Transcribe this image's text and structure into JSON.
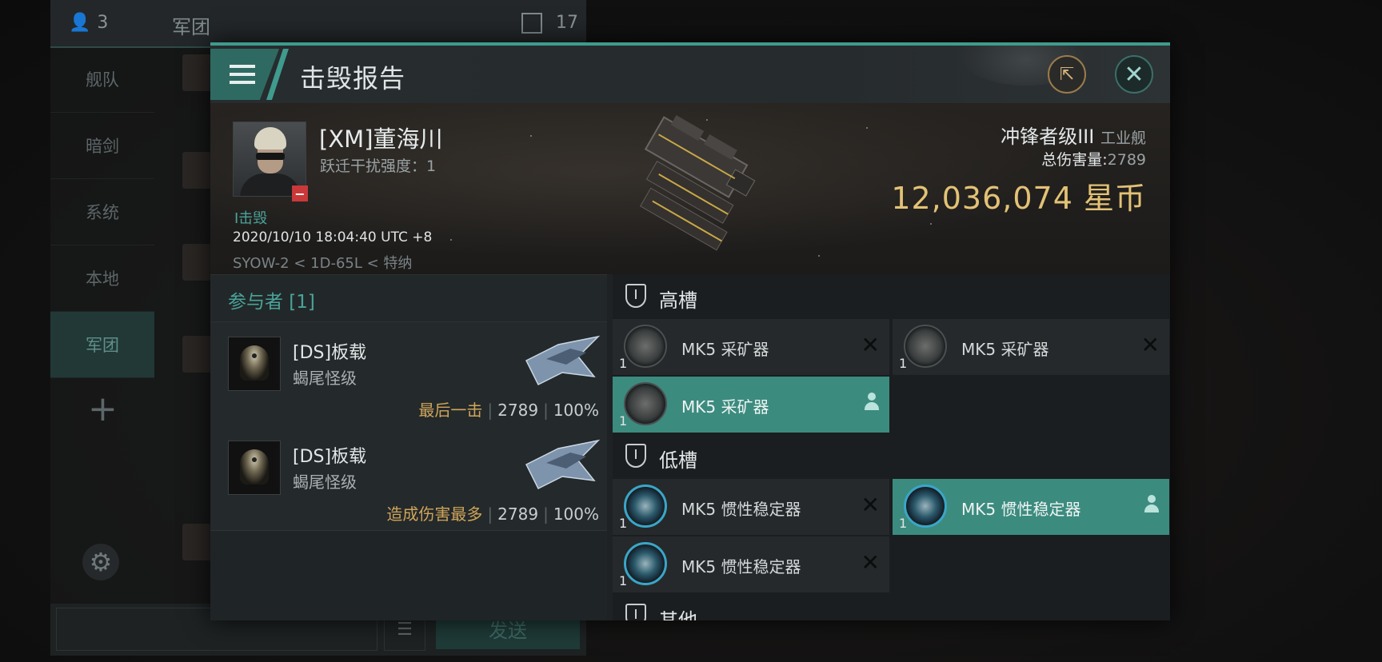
{
  "background": {
    "member_count": "3",
    "channel_title": "军团",
    "message_count": "17",
    "sidebar": [
      {
        "label": "舰队"
      },
      {
        "label": "暗剑"
      },
      {
        "label": "系统"
      },
      {
        "label": "本地"
      },
      {
        "label": "军团"
      }
    ],
    "send_label": "发送"
  },
  "dialog": {
    "title": "击毁报告",
    "victim": {
      "name": "[XM]董海川",
      "warp_disruption": "跃迁干扰强度：1",
      "kill_tag": "I击毁",
      "time": "2020/10/10 18:04:40 UTC +8",
      "location": "SYOW-2 < 1D-65L < 特纳",
      "ship_name": "冲锋者级III",
      "ship_type": "工业舰",
      "damage_label": "总伤害量:",
      "damage_value": "2789",
      "isk_value": "12,036,074",
      "isk_unit": "星币"
    },
    "participants": {
      "title": "参与者 [1]",
      "rows": [
        {
          "name": "[DS]板载",
          "ship": "蝎尾怪级",
          "tag": "最后一击",
          "damage": "2789",
          "percent": "100%"
        },
        {
          "name": "[DS]板载",
          "ship": "蝎尾怪级",
          "tag": "造成伤害最多",
          "damage": "2789",
          "percent": "100%"
        }
      ]
    },
    "fitting": {
      "high_slot_label": "高槽",
      "low_slot_label": "低槽",
      "other_label": "其他",
      "high": [
        {
          "name": "MK5 采矿器",
          "qty": "1",
          "state": "destroyed"
        },
        {
          "name": "MK5 采矿器",
          "qty": "1",
          "state": "destroyed"
        },
        {
          "name": "MK5 采矿器",
          "qty": "1",
          "state": "dropped"
        }
      ],
      "low": [
        {
          "name": "MK5 惯性稳定器",
          "qty": "1",
          "state": "destroyed"
        },
        {
          "name": "MK5 惯性稳定器",
          "qty": "1",
          "state": "dropped"
        },
        {
          "name": "MK5 惯性稳定器",
          "qty": "1",
          "state": "destroyed"
        }
      ]
    }
  },
  "colors": {
    "accent": "#3f9b8e",
    "isk_gold": "#e3c276",
    "tag_gold": "#cfa55a",
    "badge_red": "#c9393a"
  }
}
